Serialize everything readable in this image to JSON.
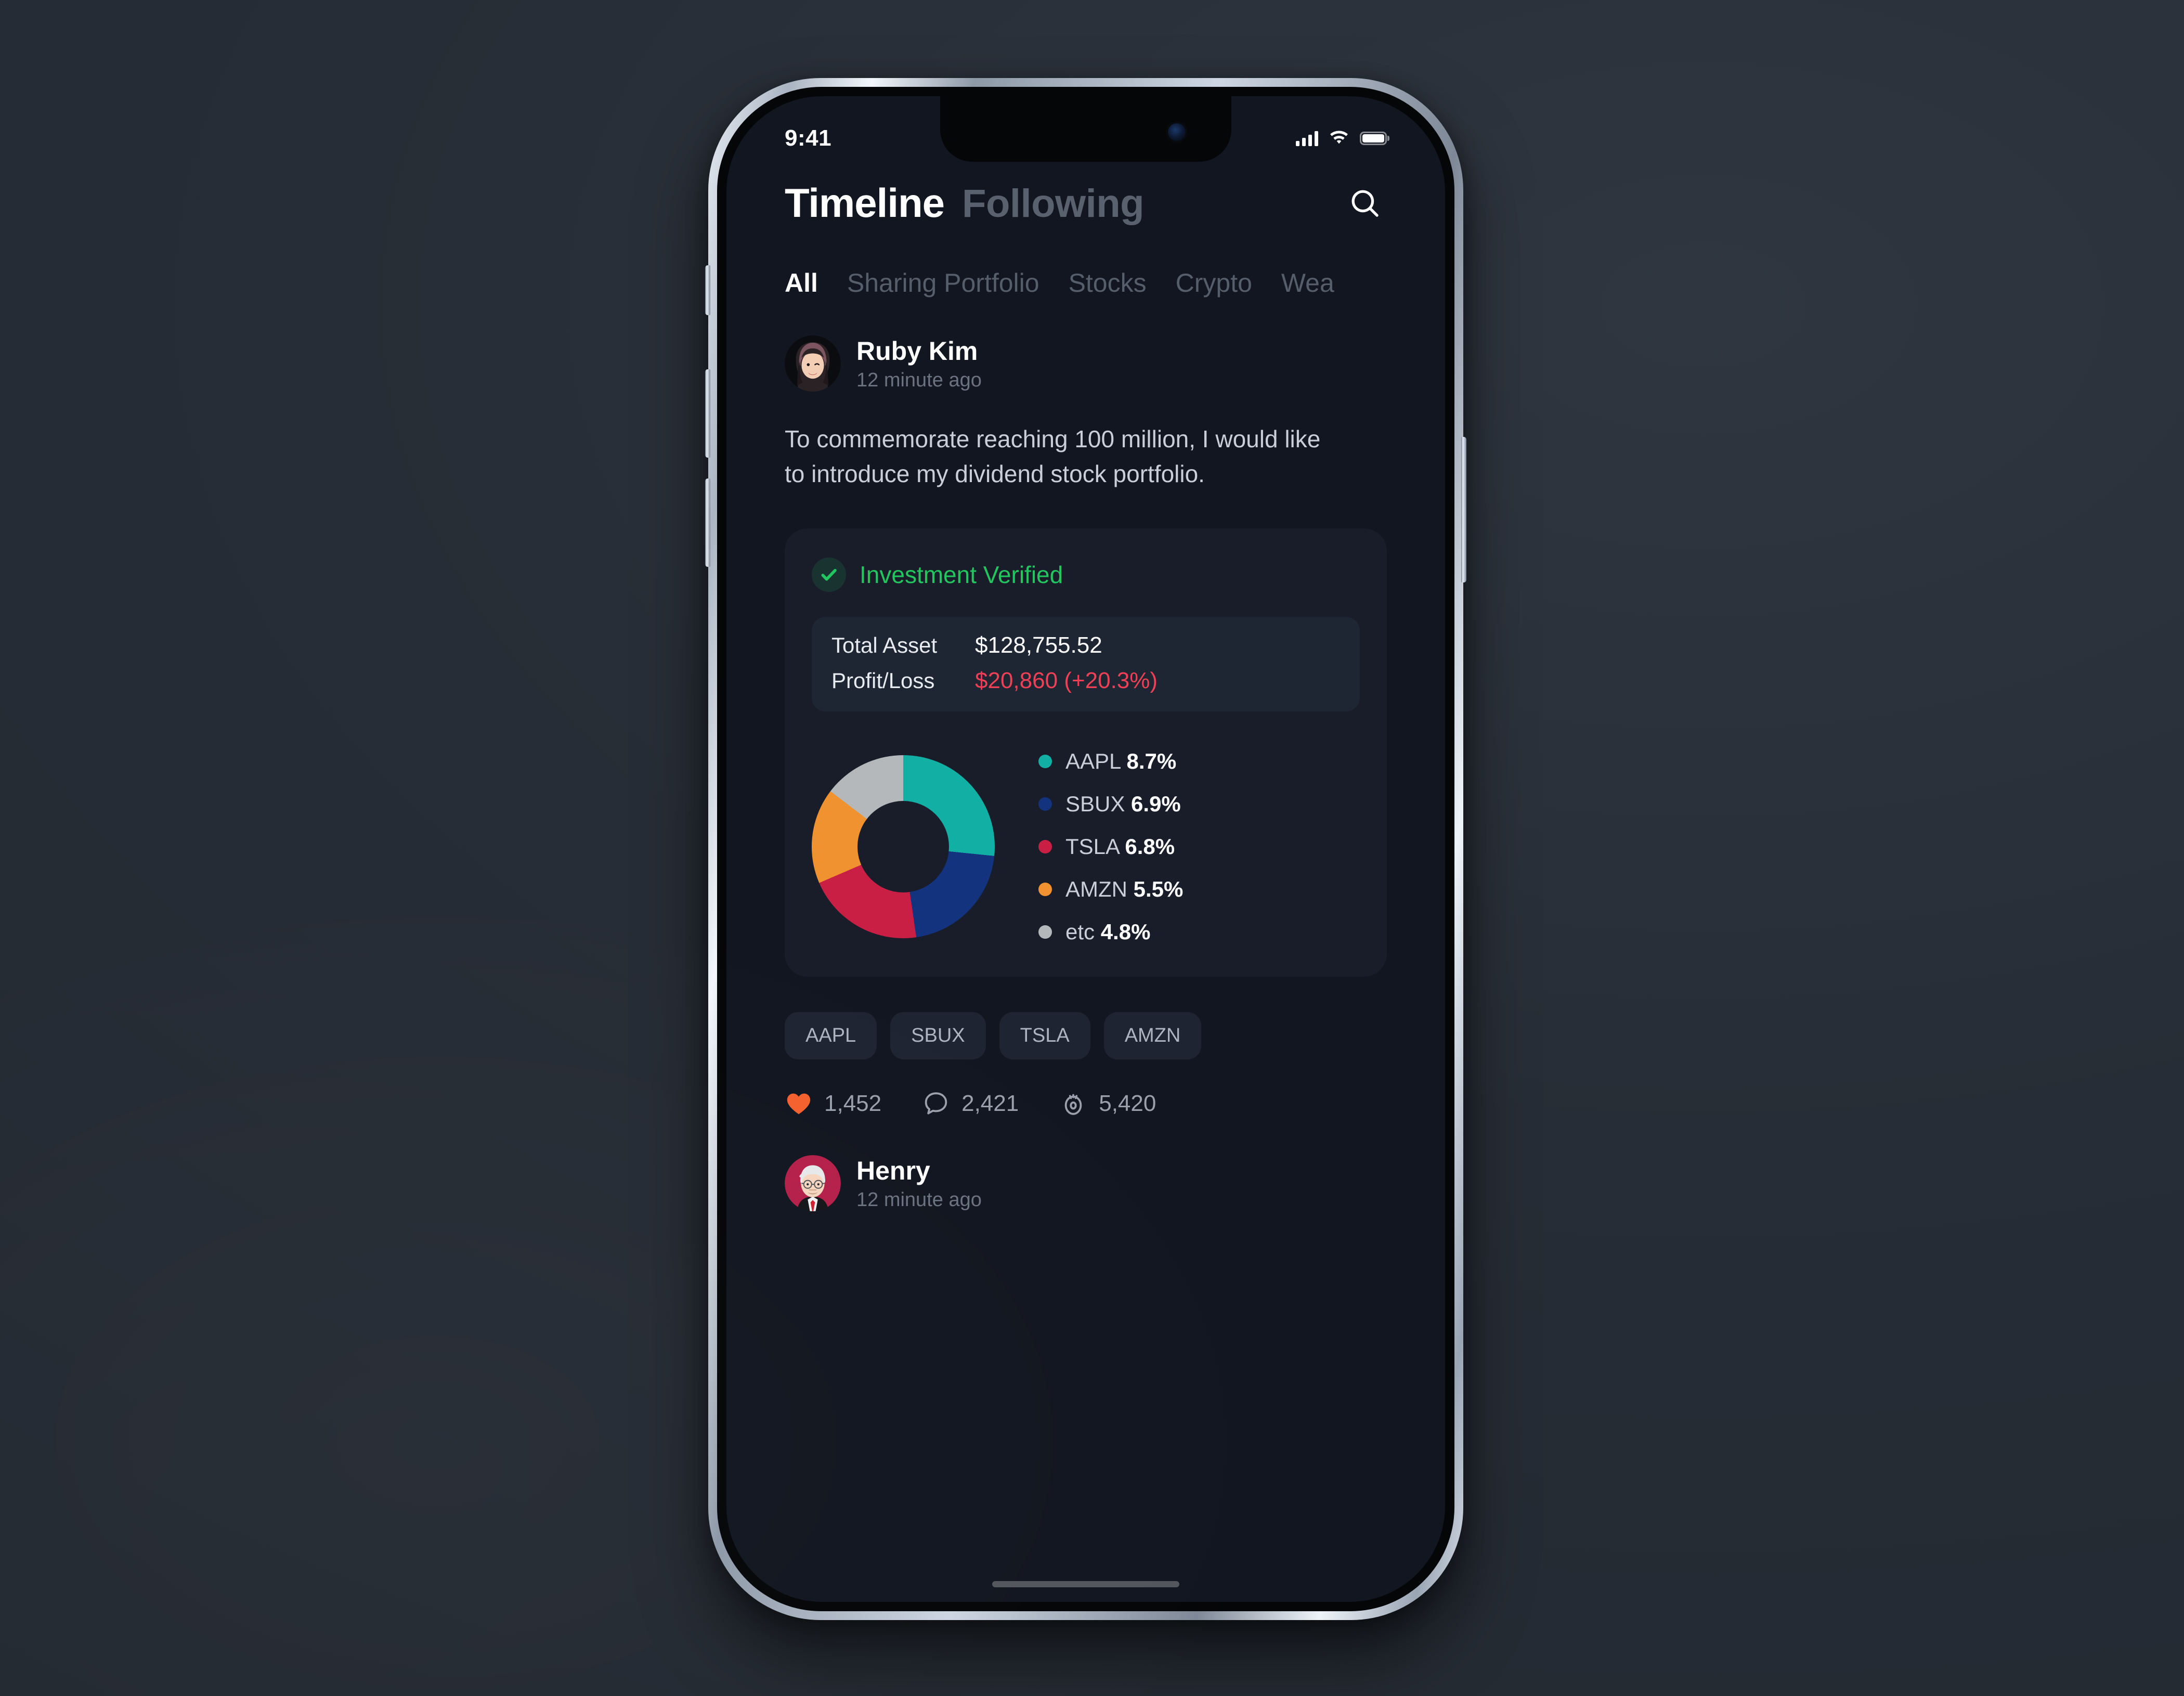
{
  "status_bar": {
    "time": "9:41",
    "signal_icon": "cellular-signal-icon",
    "wifi_icon": "wifi-icon",
    "battery_icon": "battery-full-icon"
  },
  "header": {
    "title": "Timeline",
    "secondary": "Following",
    "search_icon": "search-icon"
  },
  "tabs": [
    {
      "label": "All",
      "active": true
    },
    {
      "label": "Sharing Portfolio",
      "active": false
    },
    {
      "label": "Stocks",
      "active": false
    },
    {
      "label": "Crypto",
      "active": false
    },
    {
      "label": "Wea",
      "active": false
    }
  ],
  "posts": [
    {
      "author": "Ruby Kim",
      "timestamp": "12 minute ago",
      "avatar_name": "avatar-ruby-kim",
      "body": "To commemorate reaching 100 million, I would like to introduce my dividend stock portfolio.",
      "investment_card": {
        "verified_label": "Investment Verified",
        "verified_icon": "check-circle-icon",
        "stats": [
          {
            "label": "Total Asset",
            "value": "$128,755.52",
            "negative": false
          },
          {
            "label": "Profit/Loss",
            "value": "$20,860 (+20.3%)",
            "negative": true
          }
        ]
      },
      "tickers": [
        "AAPL",
        "SBUX",
        "TSLA",
        "AMZN"
      ],
      "engagement": [
        {
          "icon": "heart-icon",
          "count": "1,452"
        },
        {
          "icon": "comment-bubble-icon",
          "count": "2,421"
        },
        {
          "icon": "eye-view-icon",
          "count": "5,420"
        }
      ]
    },
    {
      "author": "Henry",
      "timestamp": "12 minute ago",
      "avatar_name": "avatar-henry"
    }
  ],
  "colors": {
    "backdrop": "#292f38",
    "screen_bg": "#121620",
    "card_bg": "#181d29",
    "stats_bg": "#1e2533",
    "accent_green": "#22c55e",
    "accent_red": "#ef4056",
    "accent_heart": "#f4622e",
    "text_primary": "#ffffff",
    "text_secondary": "#c9ced8",
    "text_muted": "#6b7280"
  },
  "chart_data": {
    "type": "pie",
    "title": "",
    "subtitle": "",
    "variant": "donut",
    "start_angle_deg": 0,
    "direction": "clockwise",
    "inner_radius_ratio": 0.5,
    "legend_position": "right",
    "grid": false,
    "categories": [
      "AAPL",
      "SBUX",
      "TSLA",
      "AMZN",
      "etc"
    ],
    "values": [
      8.7,
      6.9,
      6.8,
      5.5,
      4.8
    ],
    "value_labels": [
      "8.7%",
      "6.9%",
      "6.8%",
      "5.5%",
      "4.8%"
    ],
    "colors": [
      "#12b0a4",
      "#13337f",
      "#c91f45",
      "#f0922f",
      "#b5b8bb"
    ],
    "total_of_values": 32.7,
    "normalized_share_pct": [
      26.6,
      21.1,
      20.8,
      16.8,
      14.7
    ],
    "slices": [
      {
        "name": "AAPL",
        "value": 8.7,
        "label": "AAPL 8.7%",
        "color": "#12b0a4",
        "share_pct": 26.6,
        "start_deg": 0.0,
        "end_deg": 95.8
      },
      {
        "name": "SBUX",
        "value": 6.9,
        "label": "SBUX 6.9%",
        "color": "#13337f",
        "share_pct": 21.1,
        "start_deg": 95.8,
        "end_deg": 171.8
      },
      {
        "name": "TSLA",
        "value": 6.8,
        "label": "TSLA 6.8%",
        "color": "#c91f45",
        "share_pct": 20.8,
        "start_deg": 171.8,
        "end_deg": 246.7
      },
      {
        "name": "AMZN",
        "value": 5.5,
        "label": "AMZN 5.5%",
        "color": "#f0922f",
        "share_pct": 16.8,
        "start_deg": 246.7,
        "end_deg": 307.3
      },
      {
        "name": "etc",
        "value": 4.8,
        "label": "etc 4.8%",
        "color": "#b5b8bb",
        "share_pct": 14.7,
        "start_deg": 307.3,
        "end_deg": 360.0
      }
    ],
    "xlabel": "",
    "ylabel": ""
  }
}
